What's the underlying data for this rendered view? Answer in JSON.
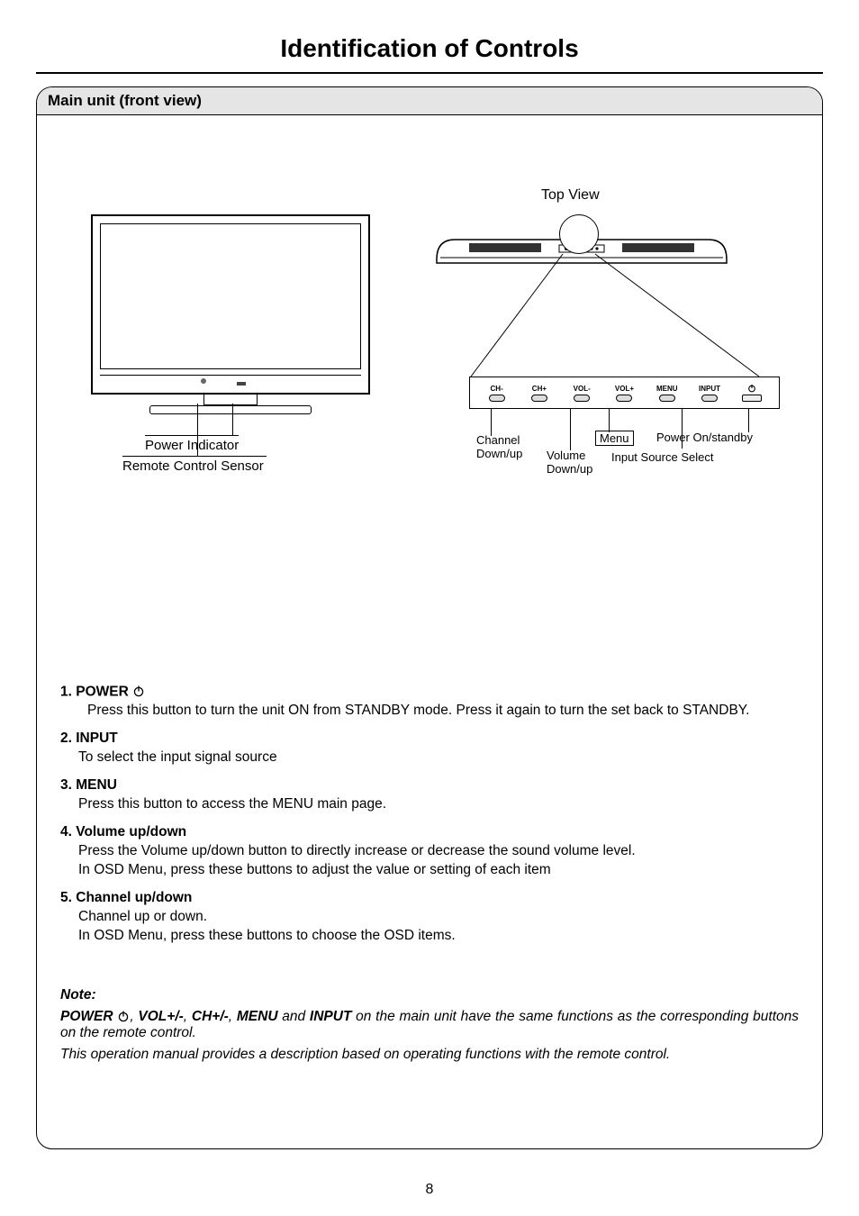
{
  "page": {
    "title": "Identification of Controls",
    "section_header": "Main unit (front view)",
    "page_number": "8"
  },
  "front_view": {
    "power_indicator": "Power Indicator",
    "remote_sensor": "Remote Control Sensor"
  },
  "top_view": {
    "label": "Top View",
    "buttons": {
      "ch_minus": "CH-",
      "ch_plus": "CH+",
      "vol_minus": "VOL-",
      "vol_plus": "VOL+",
      "menu": "MENU",
      "input": "INPUT"
    },
    "callouts": {
      "channel": "Channel\nDown/up",
      "volume": "Volume\nDown/up",
      "menu": "Menu",
      "input_src": "Input Source Select",
      "power": "Power On/standby"
    }
  },
  "items": [
    {
      "num": "1.",
      "title": "POWER",
      "has_power_icon": true,
      "body": "Press this button to turn the unit ON from STANDBY mode. Press it again to turn the set back to STANDBY."
    },
    {
      "num": "2",
      "title": ". INPUT",
      "body": "To select the input signal source"
    },
    {
      "num": "3.",
      "title": "MENU",
      "body": "Press this button to access the MENU main page."
    },
    {
      "num": "4.",
      "title": "Volume up/down",
      "body": "Press the Volume up/down  button to directly increase or decrease the sound volume level.\nIn OSD Menu, press these buttons to adjust the value or setting of each item"
    },
    {
      "num": "5.",
      "title": "Channel up/down",
      "body": "Channel up or down.\nIn OSD Menu, press these buttons to choose the OSD items."
    }
  ],
  "note": {
    "heading": "Note:",
    "segments": {
      "power": "POWER",
      "sep1": ",",
      "vol": "VOL+/-",
      "sep2": ", ",
      "ch": "CH+/-",
      "sep3": ", ",
      "menu": "MENU",
      "and": " and ",
      "input": "INPUT",
      "rest": " on the main unit have the same functions as the corresponding buttons on the remote control."
    },
    "line2": "This operation manual provides a description based on operating functions with the remote control."
  }
}
